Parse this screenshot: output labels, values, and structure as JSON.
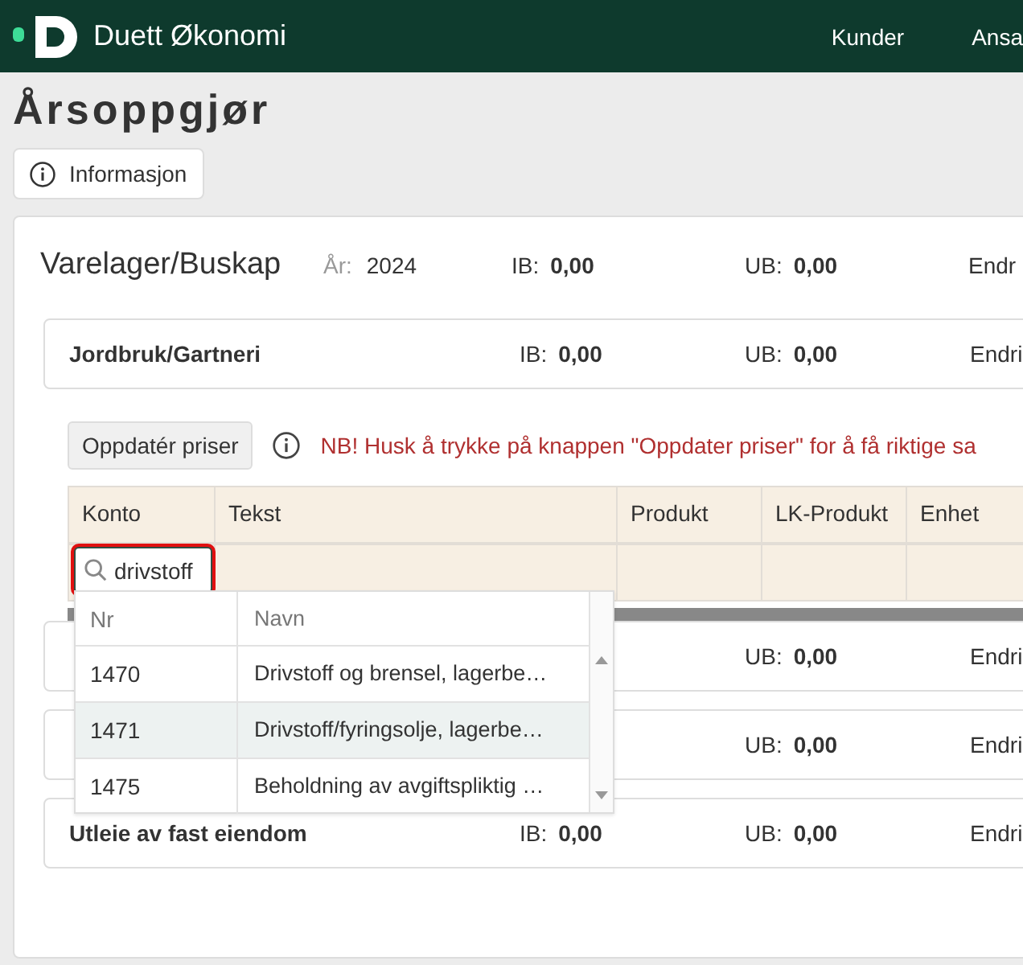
{
  "header": {
    "brand": "Duett Økonomi",
    "nav": [
      {
        "label": "Kunder"
      },
      {
        "label": "Ansa"
      }
    ]
  },
  "page": {
    "title": "Årsoppgjør",
    "info_button": "Informasjon"
  },
  "section": {
    "title": "Varelager/Buskap",
    "year_label": "År:",
    "year": "2024",
    "ib_label": "IB:",
    "ib": "0,00",
    "ub_label": "UB:",
    "ub": "0,00",
    "change_label": "Endr"
  },
  "groups": [
    {
      "name": "Jordbruk/Gartneri",
      "ib_label": "IB:",
      "ib": "0,00",
      "ub_label": "UB:",
      "ub": "0,00",
      "change_label": "Endri"
    },
    {
      "ub_label": "UB:",
      "ub": "0,00",
      "change_label": "Endri"
    },
    {
      "ub_label": "UB:",
      "ub": "0,00",
      "change_label": "Endri"
    },
    {
      "name": "Utleie av fast eiendom",
      "ib_label": "IB:",
      "ib": "0,00",
      "ub_label": "UB:",
      "ub": "0,00",
      "change_label": "Endri"
    }
  ],
  "toolbar": {
    "button": "Oppdatér priser",
    "notice": "NB! Husk å trykke på knappen \"Oppdater priser\" for å få riktige sa"
  },
  "table": {
    "columns": [
      "Konto",
      "Tekst",
      "Produkt",
      "LK-Produkt",
      "Enhet"
    ],
    "filter": {
      "value": "drivstoff",
      "focused": true
    }
  },
  "dropdown": {
    "columns": [
      "Nr",
      "Navn"
    ],
    "rows": [
      {
        "nr": "1470",
        "name": "Drivstoff og brensel, lagerbe…",
        "selected": false
      },
      {
        "nr": "1471",
        "name": "Drivstoff/fyringsolje, lagerbe…",
        "selected": true
      },
      {
        "nr": "1475",
        "name": "Beholdning av avgiftspliktig …",
        "selected": false
      }
    ]
  }
}
